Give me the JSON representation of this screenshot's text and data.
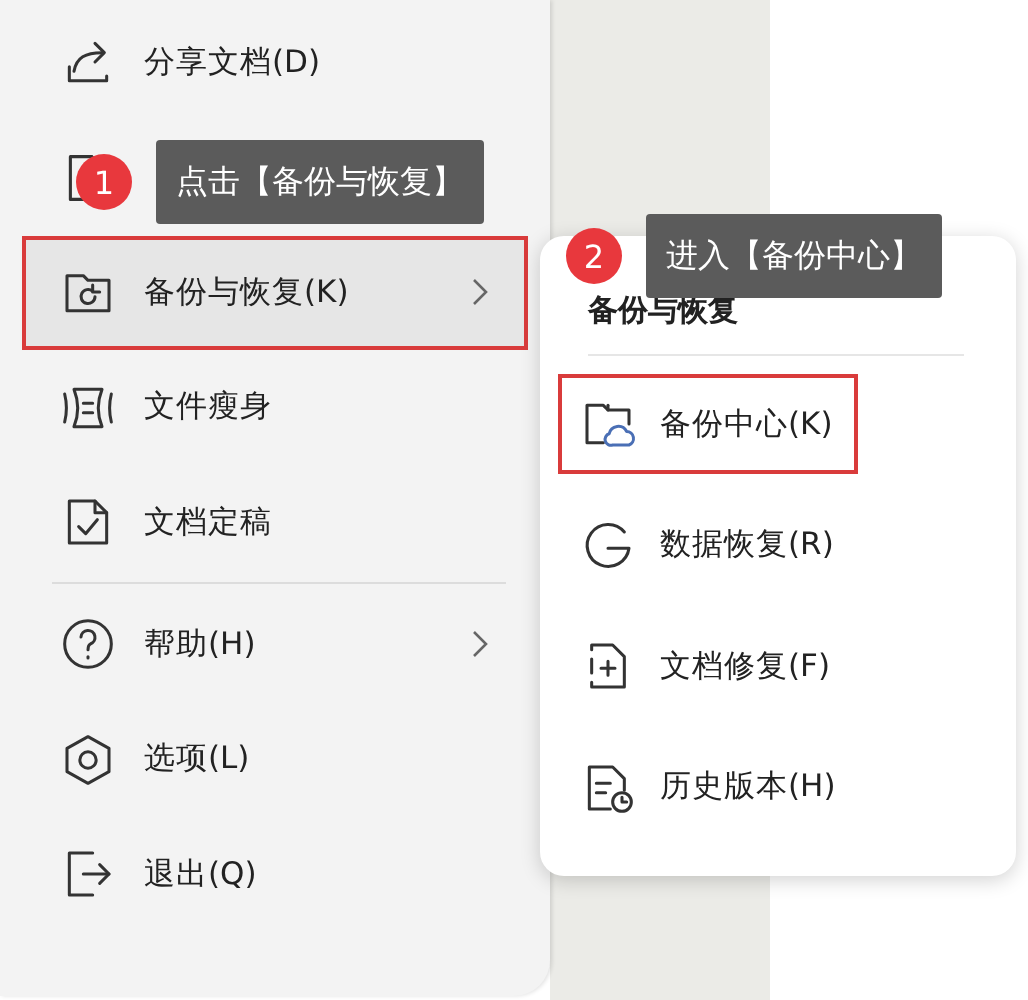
{
  "menu": {
    "groups": [
      {
        "items": [
          {
            "label": "分享文档(D)",
            "selected": false,
            "submenu": false,
            "highlighted": false
          },
          {
            "selected": false
          },
          {
            "label": "备份与恢复(K)",
            "selected": true,
            "submenu": true,
            "highlighted": true
          },
          {
            "label": "文件瘦身",
            "selected": false,
            "submenu": false,
            "highlighted": false
          },
          {
            "label": "文档定稿",
            "selected": false,
            "submenu": false,
            "highlighted": false
          }
        ]
      },
      {
        "items": [
          {
            "label": "帮助(H)",
            "selected": false,
            "submenu": true,
            "highlighted": false
          },
          {
            "label": "选项(L)",
            "selected": false,
            "submenu": false,
            "highlighted": false
          },
          {
            "label": "退出(Q)",
            "selected": false,
            "submenu": false,
            "highlighted": false
          }
        ]
      }
    ]
  },
  "submenu": {
    "title": "备份与恢复",
    "items": [
      {
        "label": "备份中心(K)",
        "highlighted": true
      },
      {
        "label": "数据恢复(R)",
        "highlighted": false
      },
      {
        "label": "文档修复(F)",
        "highlighted": false
      },
      {
        "label": "历史版本(H)",
        "highlighted": false
      }
    ]
  },
  "callouts": [
    {
      "step": "1",
      "text": "点击【备份与恢复】"
    },
    {
      "step": "2",
      "text": "进入【备份中心】"
    }
  ]
}
